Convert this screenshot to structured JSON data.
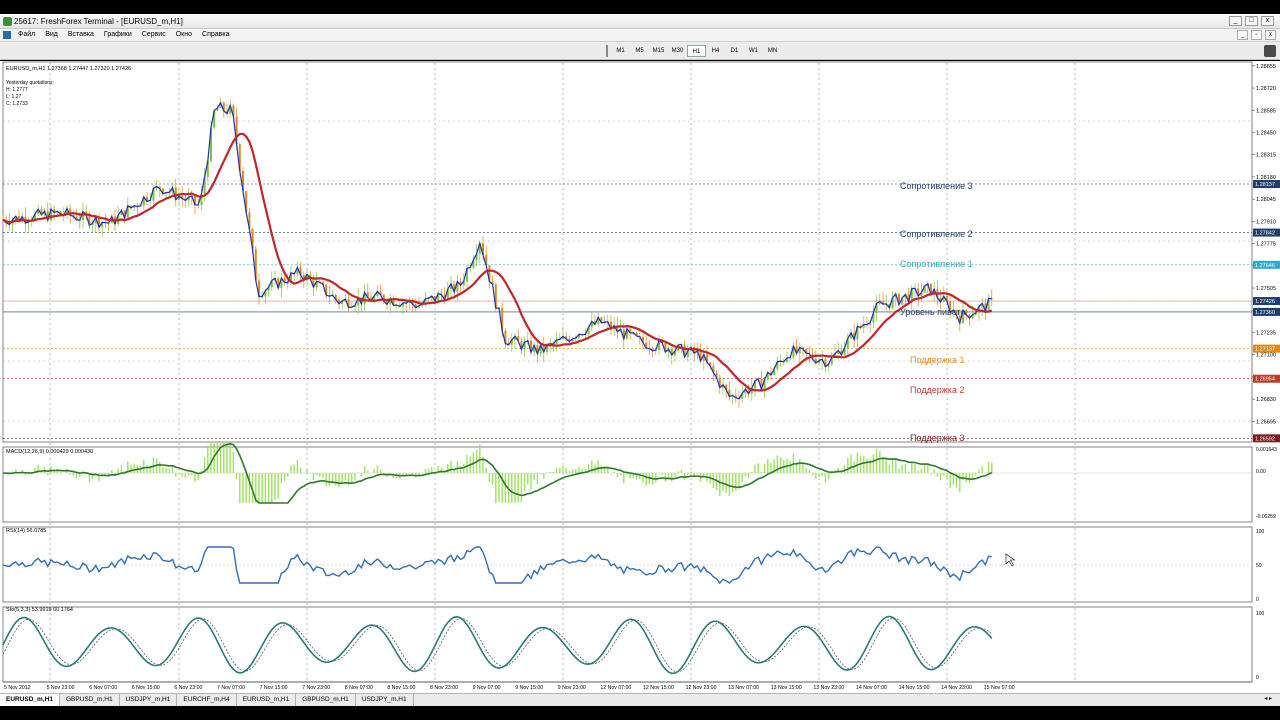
{
  "window": {
    "title": "25617: FreshForex Terminal - [EURUSD_m,H1]",
    "min": "_",
    "max": "□",
    "close": "x"
  },
  "menu": [
    "Файл",
    "Вид",
    "Вставка",
    "Графики",
    "Сервис",
    "Окно",
    "Справка"
  ],
  "timeframes": [
    "M1",
    "M5",
    "M15",
    "M30",
    "H1",
    "H4",
    "D1",
    "W1",
    "MN"
  ],
  "active_timeframe": "H1",
  "chart": {
    "symbol_info": "EURUSD_m,H1  1.27368 1.27447 1.27320 1.27426",
    "yesterday": [
      "Yesterday quotations:",
      "H: 1.2777",
      "L: 1.27",
      "C: 1.2733"
    ],
    "price_ticks": [
      "1.28855",
      "1.28720",
      "1.28585",
      "1.28450",
      "1.28315",
      "1.28180",
      "1.28045",
      "1.27910",
      "1.27775",
      "1.27640",
      "1.27505",
      "1.27370",
      "1.27235",
      "1.27100",
      "1.26965",
      "1.26830",
      "1.26695"
    ],
    "price_tags": [
      {
        "label": "1.28137",
        "color": "#1f3f6a"
      },
      {
        "label": "1.27842",
        "color": "#1f3f6a"
      },
      {
        "label": "1.27646",
        "color": "#35a9c9"
      },
      {
        "label": "1.27426",
        "color": "#1f3f6a"
      },
      {
        "label": "1.27360",
        "color": "#1f3f6a"
      },
      {
        "label": "1.27137",
        "color": "#e0881a"
      },
      {
        "label": "1.26954",
        "color": "#c0392b"
      },
      {
        "label": "1.26592",
        "color": "#7a1f1f"
      }
    ],
    "levels": [
      {
        "label": "Сопротивление 3",
        "color": "#1f3f6a"
      },
      {
        "label": "Сопротивление 2",
        "color": "#1f3f6a"
      },
      {
        "label": "Сопротивление 1",
        "color": "#35a9c9"
      },
      {
        "label": "Уровень пивота",
        "color": "#1f3f6a"
      },
      {
        "label": "Поддержка 1",
        "color": "#e0881a"
      },
      {
        "label": "Поддержка 2",
        "color": "#c0392b"
      },
      {
        "label": "Поддержка 3",
        "color": "#7a1f1f"
      }
    ],
    "macd": {
      "label": "MACD(12,26,9) 0.000429 0.000430",
      "ticks": [
        "0.001643",
        "0.00",
        "-0.00259"
      ]
    },
    "rsi": {
      "label": "RSI(14) 56.0785",
      "ticks": [
        "100",
        "50",
        "0"
      ]
    },
    "sto": {
      "label": "Sto(5,3,3) 53.9919 60.1764",
      "ticks": [
        "100",
        "0"
      ]
    },
    "time_labels": [
      "5 Nov 2012",
      "5 Nov 23:00",
      "6 Nov 07:00",
      "6 Nov 15:00",
      "6 Nov 23:00",
      "7 Nov 07:00",
      "7 Nov 15:00",
      "7 Nov 23:00",
      "8 Nov 07:00",
      "8 Nov 15:00",
      "8 Nov 23:00",
      "9 Nov 07:00",
      "9 Nov 15:00",
      "9 Nov 23:00",
      "12 Nov 07:00",
      "12 Nov 15:00",
      "12 Nov 23:00",
      "13 Nov 07:00",
      "13 Nov 15:00",
      "13 Nov 23:00",
      "14 Nov 07:00",
      "14 Nov 15:00",
      "14 Nov 23:00",
      "15 Nov 07:00"
    ],
    "colors": {
      "bull": "#7cc43a",
      "bear": "#e0881a",
      "price_line": "#1a32b8",
      "ma": "#c0262b",
      "macd_hist": "#9be35a",
      "macd_signal": "#2b7a2b",
      "rsi": "#2f6fb5",
      "sto_main": "#2a7a7a"
    }
  },
  "tabs": [
    "EURUSD_m,H1",
    "GBPUSD_m,H1",
    "USDJPY_m,H1",
    "EURCHF_m,H4",
    "EURUSD_m,H1",
    "GBPUSD_m,H1",
    "USDJPY_m,H1"
  ],
  "active_tab": 0
}
